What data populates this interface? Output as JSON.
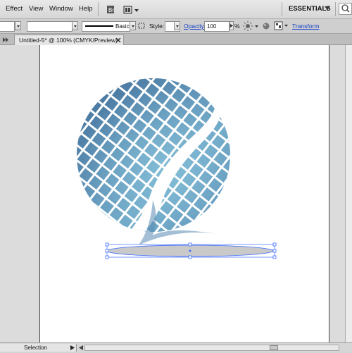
{
  "menubar": {
    "items": [
      "Effect",
      "View",
      "Window",
      "Help"
    ],
    "workspace": "ESSENTIALS"
  },
  "controlbar": {
    "stroke_profile": "Basic",
    "style_label": "Style:",
    "opacity_label": "Opacity:",
    "opacity_value": "100",
    "opacity_unit": "%",
    "transform_label": "Transform"
  },
  "document": {
    "tab_title": "Untitled-5* @ 100% (CMYK/Preview)"
  },
  "statusbar": {
    "tool": "Selection"
  },
  "colors": {
    "accent_link": "#1540c8",
    "sphere_dark": "#3f6a96",
    "sphere_light": "#85bfd8",
    "selection": "#3d6bff"
  },
  "icons": [
    "bridge-icon",
    "arrange-documents-icon",
    "search-icon",
    "selector-icon",
    "recolor-icon",
    "align-icon"
  ]
}
